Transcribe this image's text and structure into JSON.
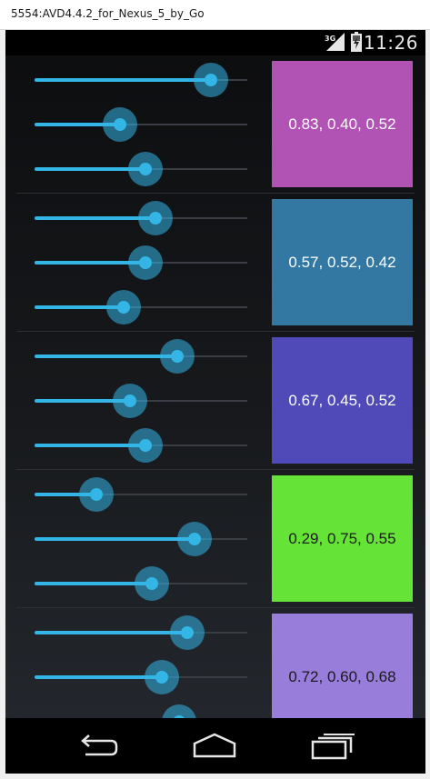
{
  "window": {
    "title": "5554:AVD4.4.2_for_Nexus_5_by_Go"
  },
  "status_bar": {
    "network_label": "3G",
    "time": "11:26",
    "icons": [
      "signal-3g-icon",
      "battery-icon"
    ]
  },
  "rows": [
    {
      "sliders": [
        0.83,
        0.4,
        0.52
      ],
      "label": "0.83, 0.40, 0.52",
      "color": "#b053b4",
      "text_color": "#ffffff"
    },
    {
      "sliders": [
        0.57,
        0.52,
        0.42
      ],
      "label": "0.57, 0.52, 0.42",
      "color": "#3378a3",
      "text_color": "#ffffff"
    },
    {
      "sliders": [
        0.67,
        0.45,
        0.52
      ],
      "label": "0.67, 0.45, 0.52",
      "color": "#4f4ab8",
      "text_color": "#ffffff"
    },
    {
      "sliders": [
        0.29,
        0.75,
        0.55
      ],
      "label": "0.29, 0.75, 0.55",
      "color": "#66e337",
      "text_color": "#1a1a1a"
    },
    {
      "sliders": [
        0.72,
        0.6,
        0.68
      ],
      "label": "0.72, 0.60, 0.68",
      "color": "#987ddb",
      "text_color": "#1a1a1a"
    }
  ],
  "nav_bar": {
    "buttons": [
      "back-icon",
      "home-icon",
      "recents-icon"
    ]
  },
  "colors": {
    "accent": "#33b5e5",
    "background": "#111316",
    "status_bar": "#000000"
  }
}
